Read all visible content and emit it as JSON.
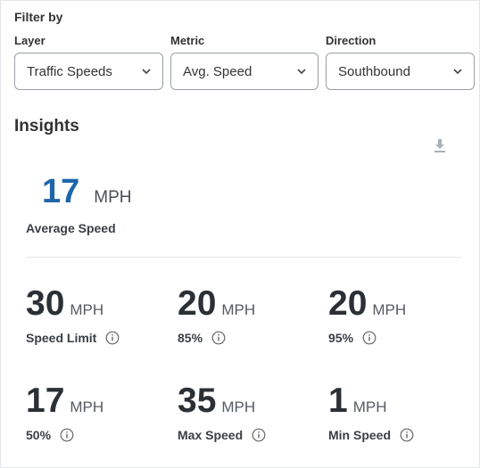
{
  "filter": {
    "title": "Filter by",
    "layer": {
      "label": "Layer",
      "value": "Traffic Speeds"
    },
    "metric": {
      "label": "Metric",
      "value": "Avg. Speed"
    },
    "direction": {
      "label": "Direction",
      "value": "Southbound"
    }
  },
  "insights": {
    "title": "Insights",
    "download_icon": "download-icon",
    "accent_color": "#1d66a8",
    "average": {
      "value": "17",
      "unit": "MPH",
      "label": "Average Speed"
    },
    "metrics": [
      {
        "value": "30",
        "unit": "MPH",
        "label": "Speed Limit"
      },
      {
        "value": "20",
        "unit": "MPH",
        "label": "85%"
      },
      {
        "value": "20",
        "unit": "MPH",
        "label": "95%"
      },
      {
        "value": "17",
        "unit": "MPH",
        "label": "50%"
      },
      {
        "value": "35",
        "unit": "MPH",
        "label": "Max Speed"
      },
      {
        "value": "1",
        "unit": "MPH",
        "label": "Min Speed"
      }
    ]
  }
}
